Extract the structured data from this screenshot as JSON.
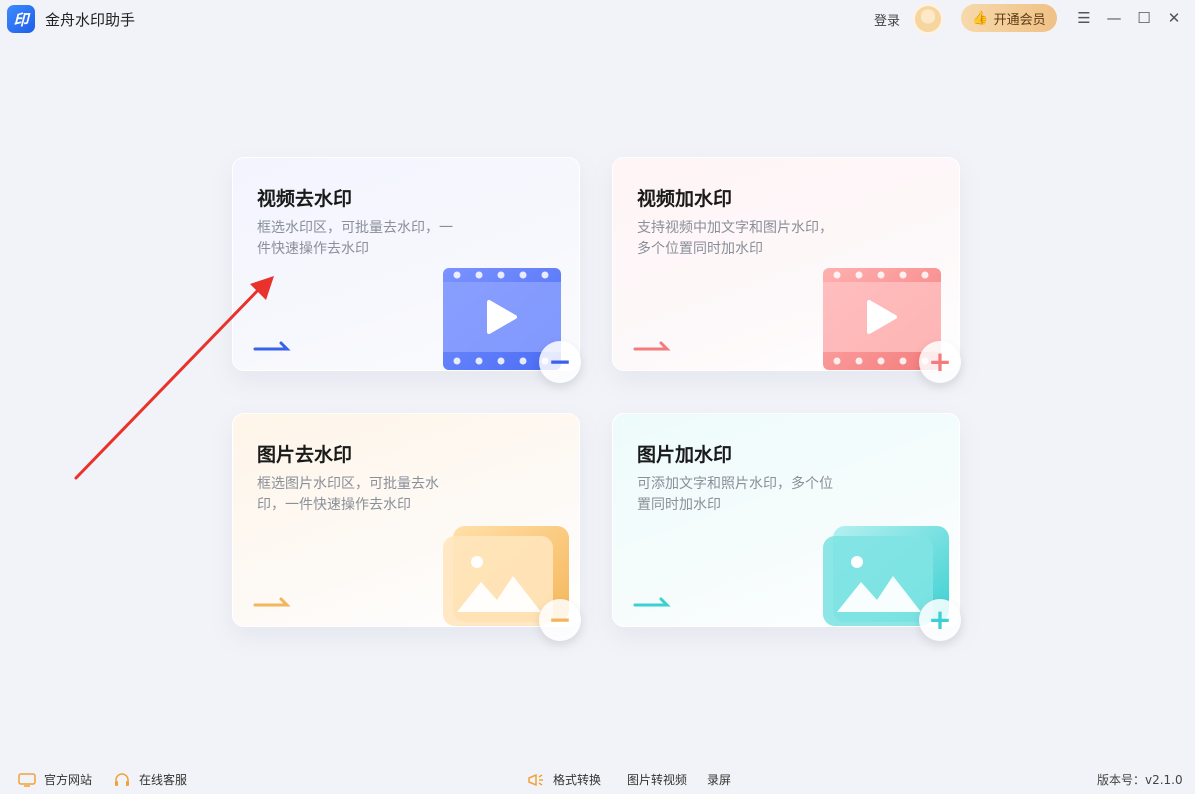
{
  "app": {
    "title": "金舟水印助手",
    "logo_text": "印"
  },
  "header": {
    "login_label": "登录",
    "vip_label": "开通会员",
    "vip_icon": "thumbs-up-icon"
  },
  "cards": [
    {
      "title": "视频去水印",
      "desc": "框选水印区，可批量去水印，一件快速操作去水印",
      "accent": "#3a61ea",
      "badge": "−"
    },
    {
      "title": "视频加水印",
      "desc": "支持视频中加文字和图片水印，多个位置同时加水印",
      "accent": "#f47b7b",
      "badge": "+"
    },
    {
      "title": "图片去水印",
      "desc": "框选图片水印区，可批量去水印，一件快速操作去水印",
      "accent": "#f2b65a",
      "badge": "−"
    },
    {
      "title": "图片加水印",
      "desc": "可添加文字和照片水印，多个位置同时加水印",
      "accent": "#3bd0d2",
      "badge": "+"
    }
  ],
  "footer": {
    "official_site": "官方网站",
    "online_service": "在线客服",
    "format_convert": "格式转换",
    "image_to_video": "图片转视频",
    "screen_record": "录屏",
    "version": "版本号：v2.1.0"
  },
  "colors": {
    "background": "#f2f3f8",
    "brand": "#2a6af0",
    "annotation_arrow": "#e8322b"
  }
}
